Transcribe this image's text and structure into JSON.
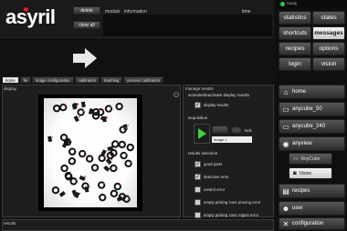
{
  "header": {
    "logo": "asyril",
    "delete_label": "delete",
    "clear_all_label": "clear all",
    "col_module": "module",
    "col_information": "information",
    "col_time": "time"
  },
  "status": {
    "text": "ready",
    "led_color": "#2ecc40"
  },
  "top_buttons": {
    "statistics": "statistics",
    "states": "states",
    "shortcuts": "shortcuts",
    "messages": "messages",
    "recipes": "recipes",
    "options": "options",
    "login": "login",
    "vision": "vision"
  },
  "nav": {
    "home": "home",
    "anycube_50": "anycube_50",
    "anycube_240": "anycube_240",
    "anyview": "anyview",
    "anycube_sub": "AnyCube",
    "vision_sub": "Vision",
    "recipes": "recipes",
    "user": "user",
    "configuration": "configuration"
  },
  "tabs": [
    "home",
    "fw",
    "image configuration",
    "calibration",
    "teaching",
    "process calibration"
  ],
  "display_label": "display",
  "manage_results": {
    "title": "manage results",
    "activate_title": "activate/deactivate display results",
    "display_results": "display results",
    "acquisition_title": "acquisition",
    "lock_label": "lock",
    "image_select": "Image 1",
    "results_selection_title": "results selection",
    "items": [
      {
        "label": "good parts",
        "checked": true
      },
      {
        "label": "detection error",
        "checked": true
      },
      {
        "label": "control error",
        "checked": false
      },
      {
        "label": "empty picking zone proving error",
        "checked": false
      },
      {
        "label": "empty picking zone region error",
        "checked": false
      }
    ]
  },
  "results_label": "results",
  "colors": {
    "accent_green": "#2ecc40",
    "brand_red": "#e31b23",
    "active_button": "#e8e8e8"
  }
}
